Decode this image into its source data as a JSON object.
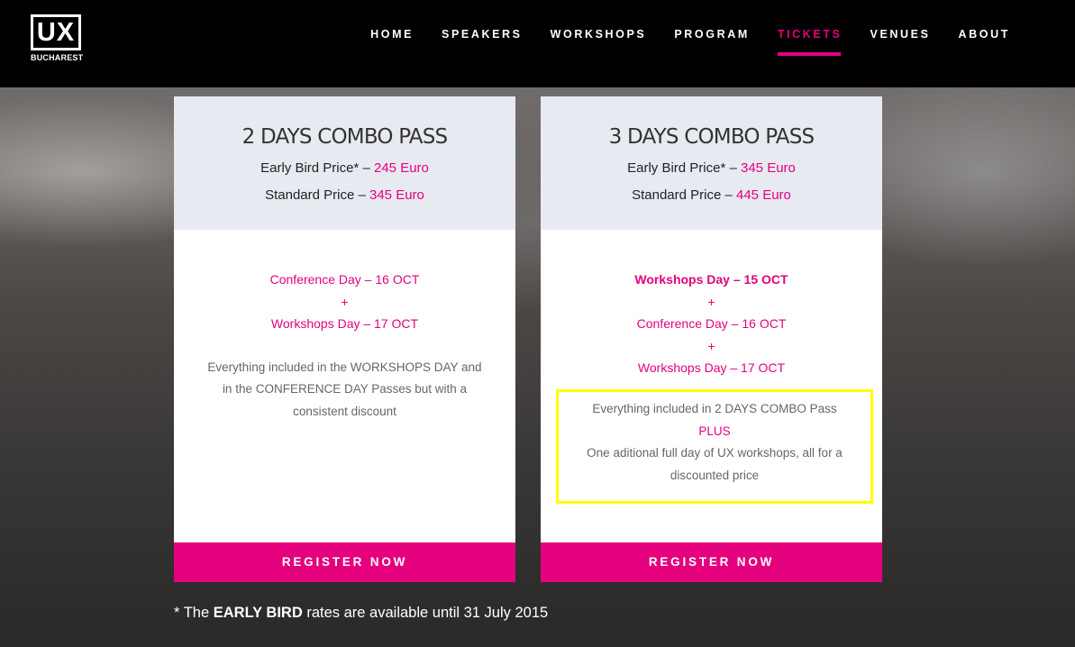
{
  "brand": {
    "logo_text": "UX",
    "logo_sub": "BUCHAREST"
  },
  "nav": {
    "items": [
      {
        "label": "HOME"
      },
      {
        "label": "SPEAKERS"
      },
      {
        "label": "WORKSHOPS"
      },
      {
        "label": "PROGRAM"
      },
      {
        "label": "TICKETS",
        "active": true
      },
      {
        "label": "VENUES"
      },
      {
        "label": "ABOUT"
      }
    ]
  },
  "cards": [
    {
      "title": "2 DAYS COMBO PASS",
      "early_label": "Early Bird Price* –",
      "early_price": "245 Euro",
      "standard_label": "Standard Price –",
      "standard_price": "345 Euro",
      "days": [
        "Conference Day – 16 OCT",
        "+",
        "Workshops Day – 17 OCT"
      ],
      "description": "Everything included in the WORKSHOPS DAY and in the CONFERENCE DAY Passes but with a consistent discount",
      "button": "REGISTER NOW"
    },
    {
      "title": "3 DAYS COMBO PASS",
      "early_label": "Early Bird Price* –",
      "early_price": "345 Euro",
      "standard_label": "Standard Price –",
      "standard_price": "445 Euro",
      "days": [
        "Workshops Day – 15 OCT",
        "+",
        "Conference Day – 16 OCT",
        "+",
        "Workshops Day – 17 OCT"
      ],
      "desc_line1": "Everything included in 2 DAYS COMBO Pass",
      "desc_plus": "PLUS",
      "desc_line2": "One aditional full day of UX workshops, all for a discounted price",
      "button": "REGISTER NOW"
    }
  ],
  "footnote": {
    "prefix": "* The",
    "bold": "EARLY BIRD",
    "suffix": "rates are available until 31 July 2015"
  },
  "colors": {
    "accent": "#e5007e",
    "highlight_border": "#ffff00",
    "header_bg": "#000000"
  }
}
